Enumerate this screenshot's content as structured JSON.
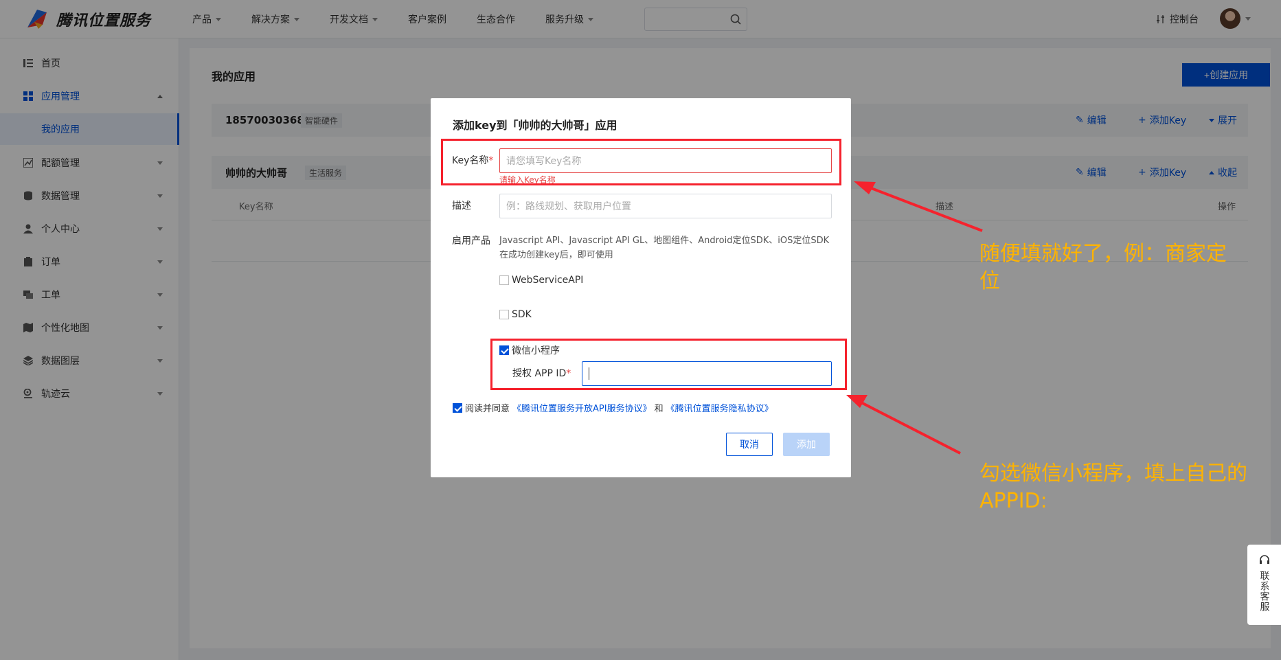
{
  "header": {
    "logo_text": "腾讯位置服务",
    "nav": [
      {
        "label": "产品",
        "has_caret": true
      },
      {
        "label": "解决方案",
        "has_caret": true
      },
      {
        "label": "开发文档",
        "has_caret": true
      },
      {
        "label": "客户案例",
        "has_caret": false
      },
      {
        "label": "生态合作",
        "has_caret": false
      },
      {
        "label": "服务升级",
        "has_caret": true
      }
    ],
    "search_placeholder": "",
    "console_label": "控制台"
  },
  "sidebar": {
    "items": [
      {
        "label": "首页",
        "icon": "home-list-icon"
      },
      {
        "label": "应用管理",
        "icon": "grid-icon",
        "expanded": true
      },
      {
        "label": "我的应用",
        "sub": true
      },
      {
        "label": "配额管理",
        "icon": "chart-icon"
      },
      {
        "label": "数据管理",
        "icon": "database-icon"
      },
      {
        "label": "个人中心",
        "icon": "user-icon"
      },
      {
        "label": "订单",
        "icon": "clipboard-icon"
      },
      {
        "label": "工单",
        "icon": "ticket-icon"
      },
      {
        "label": "个性化地图",
        "icon": "map-icon"
      },
      {
        "label": "数据图层",
        "icon": "layers-icon"
      },
      {
        "label": "轨迹云",
        "icon": "track-icon"
      }
    ]
  },
  "main": {
    "title": "我的应用",
    "create_label": "+创建应用",
    "apps": [
      {
        "name": "18570030368",
        "tag": "智能硬件",
        "edit": "编辑",
        "add_key": "添加Key",
        "toggle": "展开"
      },
      {
        "name": "帅帅的大帅哥",
        "tag": "生活服务",
        "edit": "编辑",
        "add_key": "添加Key",
        "toggle": "收起"
      }
    ],
    "table_headers": {
      "key_name": "Key名称",
      "desc": "描述",
      "ops": "操作"
    }
  },
  "modal": {
    "title": "添加key到「帅帅的大帅哥」应用",
    "key_name_label": "Key名称",
    "key_name_placeholder": "请您填写Key名称",
    "key_name_error": "请输入Key名称",
    "desc_label": "描述",
    "desc_placeholder": "例：路线规划、获取用户位置",
    "products_label": "启用产品",
    "products_desc": "Javascript API、Javascript API GL、地图组件、Android定位SDK、iOS定位SDK在成功创建key后，即可使用",
    "opt_webservice": "WebServiceAPI",
    "opt_sdk": "SDK",
    "opt_wechat": "微信小程序",
    "appid_label": "授权 APP ID",
    "agree_prefix": "阅读并同意",
    "agree_link1": "《腾讯位置服务开放API服务协议》",
    "agree_and": "和",
    "agree_link2": "《腾讯位置服务隐私协议》",
    "cancel_label": "取消",
    "add_label": "添加"
  },
  "annotations": {
    "note1": "随便填就好了，例：商家定位",
    "note2": "勾选微信小程序，填上自己的APPID:"
  },
  "contact": {
    "label": "联系客服"
  },
  "colors": {
    "primary": "#0052d9",
    "error": "#e54545",
    "annotation": "#ffb300",
    "annotation_red": "#f5222d"
  }
}
